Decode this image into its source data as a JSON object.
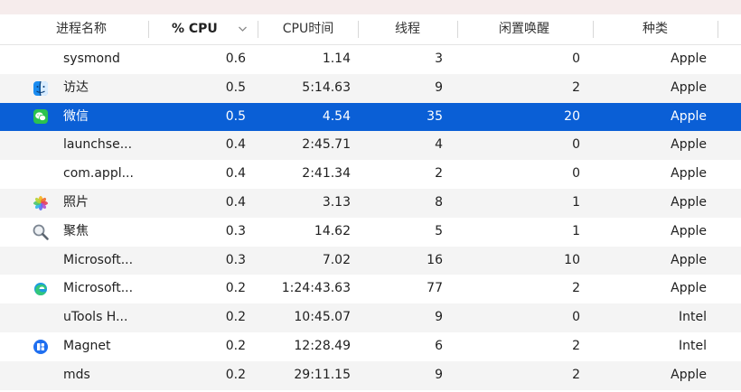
{
  "columns": {
    "name": "进程名称",
    "cpu": "% CPU",
    "cpu_time": "CPU时间",
    "threads": "线程",
    "idle_wakeups": "闲置唤醒",
    "kind": "种类"
  },
  "sort": {
    "column": "cpu",
    "direction": "descending",
    "indicator_icon": "chevron-down-icon"
  },
  "selected_row": 2,
  "processes": [
    {
      "icon": "",
      "name": "sysmond",
      "cpu": "0.6",
      "cpu_time": "1.14",
      "threads": "3",
      "idle_wakeups": "0",
      "kind": "Apple"
    },
    {
      "icon": "finder-icon",
      "name": "访达",
      "cpu": "0.5",
      "cpu_time": "5:14.63",
      "threads": "9",
      "idle_wakeups": "2",
      "kind": "Apple"
    },
    {
      "icon": "wechat-icon",
      "name": "微信",
      "cpu": "0.5",
      "cpu_time": "4.54",
      "threads": "35",
      "idle_wakeups": "20",
      "kind": "Apple"
    },
    {
      "icon": "",
      "name": "launchse...",
      "cpu": "0.4",
      "cpu_time": "2:45.71",
      "threads": "4",
      "idle_wakeups": "0",
      "kind": "Apple"
    },
    {
      "icon": "",
      "name": "com.appl...",
      "cpu": "0.4",
      "cpu_time": "2:41.34",
      "threads": "2",
      "idle_wakeups": "0",
      "kind": "Apple"
    },
    {
      "icon": "photos-icon",
      "name": "照片",
      "cpu": "0.4",
      "cpu_time": "3.13",
      "threads": "8",
      "idle_wakeups": "1",
      "kind": "Apple"
    },
    {
      "icon": "spotlight-icon",
      "name": "聚焦",
      "cpu": "0.3",
      "cpu_time": "14.62",
      "threads": "5",
      "idle_wakeups": "1",
      "kind": "Apple"
    },
    {
      "icon": "",
      "name": "Microsoft...",
      "cpu": "0.3",
      "cpu_time": "7.02",
      "threads": "16",
      "idle_wakeups": "10",
      "kind": "Apple"
    },
    {
      "icon": "edge-icon",
      "name": "Microsoft...",
      "cpu": "0.2",
      "cpu_time": "1:24:43.63",
      "threads": "77",
      "idle_wakeups": "2",
      "kind": "Apple"
    },
    {
      "icon": "",
      "name": "uTools H...",
      "cpu": "0.2",
      "cpu_time": "10:45.07",
      "threads": "9",
      "idle_wakeups": "0",
      "kind": "Intel"
    },
    {
      "icon": "magnet-icon",
      "name": "Magnet",
      "cpu": "0.2",
      "cpu_time": "12:28.49",
      "threads": "6",
      "idle_wakeups": "2",
      "kind": "Intel"
    },
    {
      "icon": "",
      "name": "mds",
      "cpu": "0.2",
      "cpu_time": "29:11.15",
      "threads": "9",
      "idle_wakeups": "2",
      "kind": "Apple"
    }
  ]
}
